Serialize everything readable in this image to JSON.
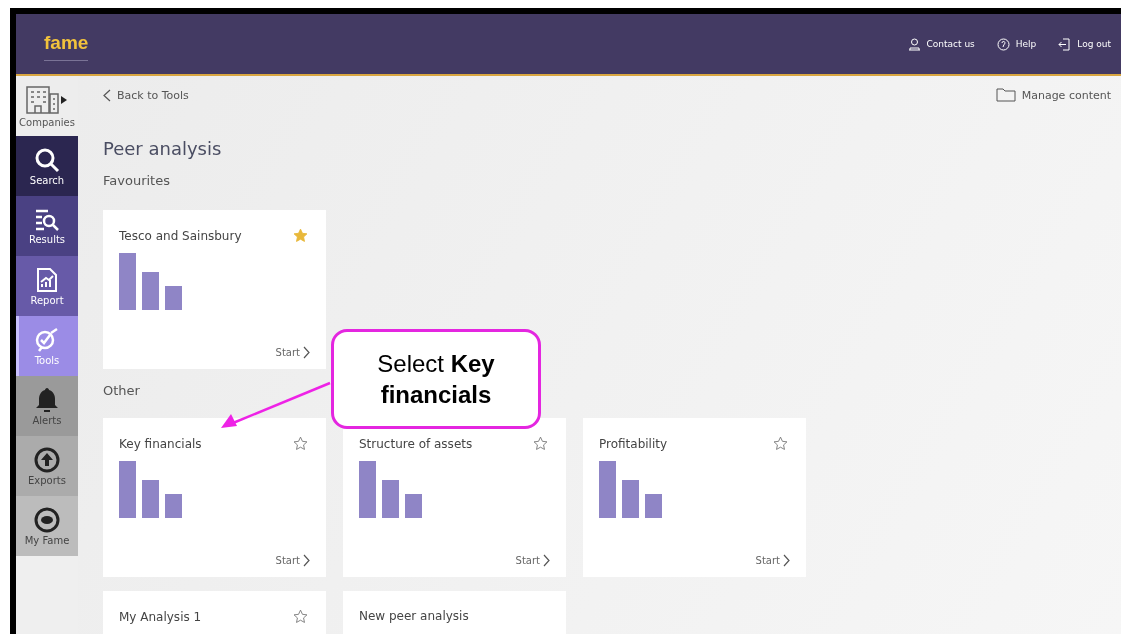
{
  "header": {
    "logo": "fame",
    "links": [
      {
        "kind": "contact",
        "label": "Contact us"
      },
      {
        "kind": "help",
        "label": "Help"
      },
      {
        "kind": "logout",
        "label": "Log out"
      }
    ]
  },
  "sidebar": {
    "items": [
      {
        "kind": "companies",
        "label": "Companies",
        "selected": false
      },
      {
        "kind": "search",
        "label": "Search",
        "selected": false
      },
      {
        "kind": "results",
        "label": "Results",
        "selected": false
      },
      {
        "kind": "report",
        "label": "Report",
        "selected": false
      },
      {
        "kind": "tools",
        "label": "Tools",
        "selected": true
      },
      {
        "kind": "alerts",
        "label": "Alerts",
        "selected": false
      },
      {
        "kind": "exports",
        "label": "Exports",
        "selected": false
      },
      {
        "kind": "myfame",
        "label": "My Fame",
        "selected": false
      }
    ]
  },
  "back_link": "Back to Tools",
  "manage_content": "Manage content",
  "title": "Peer analysis",
  "sections": [
    {
      "heading": "Favourites",
      "cards": [
        {
          "kind": "analysis",
          "title": "Tesco and Sainsbury",
          "starred": true,
          "chart": true,
          "start": "Start"
        }
      ]
    },
    {
      "heading": "Other",
      "cards": [
        {
          "kind": "analysis",
          "title": "Key financials",
          "starred": false,
          "chart": true,
          "start": "Start"
        },
        {
          "kind": "analysis",
          "title": "Structure of assets",
          "starred": false,
          "chart": true,
          "start": "Start"
        },
        {
          "kind": "analysis",
          "title": "Profitability",
          "starred": false,
          "chart": true,
          "start": "Start"
        },
        {
          "kind": "analysis",
          "title": "My Analysis 1",
          "starred": false
        },
        {
          "kind": "new",
          "title": "New peer analysis"
        }
      ]
    }
  ],
  "callout": {
    "text": "Select **Key financials**"
  }
}
